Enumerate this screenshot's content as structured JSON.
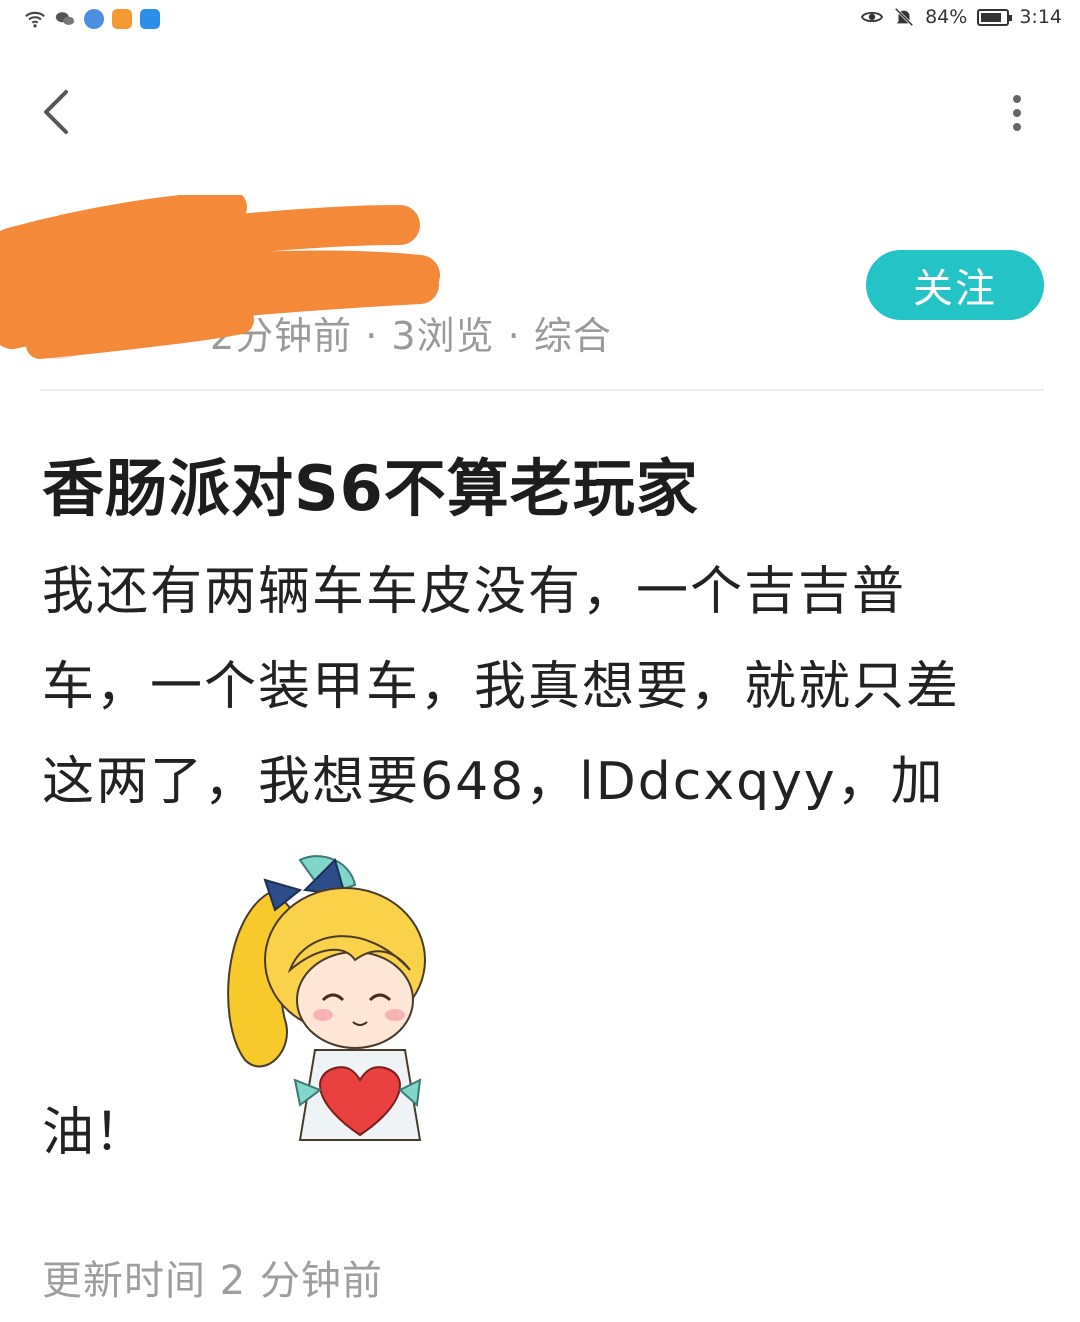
{
  "status_bar": {
    "battery_percent": "84%",
    "battery_level": 0.84,
    "time": "3:14",
    "left_icons": [
      "wifi-icon",
      "wechat-icon",
      "browser-icon",
      "video-app-icon",
      "nav-app-icon"
    ],
    "right_icons": [
      "eye-icon",
      "bell-off-icon",
      "battery-icon"
    ]
  },
  "nav": {
    "back_icon": "chevron-left-icon",
    "more_icon": "more-vertical-icon"
  },
  "author": {
    "meta": "2分钟前 · 3浏览 · 综合",
    "follow_label": "关注"
  },
  "post": {
    "title": "香肠派对S6不算老玩家",
    "body_lines": [
      "我还有两辆车车皮没有，一个吉吉普",
      "车，一个装甲车，我真想要，就就只差",
      "这两了，我想要648，lDdcxqyy，加",
      "油！"
    ],
    "updated": "更新时间 2 分钟前"
  },
  "colors": {
    "accent": "#23c3c6",
    "redaction": "#f5893a",
    "muted_text": "#9a9a9a"
  }
}
